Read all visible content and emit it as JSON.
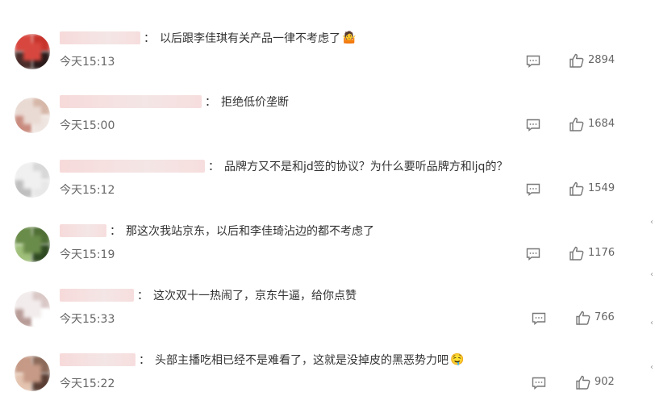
{
  "comments": [
    {
      "name_width": 100,
      "text": "以后跟李佳琪有关产品一律不考虑了",
      "emoji": "🤷",
      "time": "今天15:13",
      "likes": "2894",
      "avatar_colors": [
        "#d8473f",
        "#c7342c",
        "#4a2d2a",
        "#2c1a1a"
      ]
    },
    {
      "name_width": 176,
      "text": "拒绝低价垄断",
      "emoji": "",
      "time": "今天15:00",
      "likes": "1684",
      "avatar_colors": [
        "#e9dad3",
        "#d6b7a8",
        "#c98c7f",
        "#efe5e0"
      ]
    },
    {
      "name_width": 180,
      "text": "品牌方又不是和jd签的协议？为什么要听品牌方和ljq的？",
      "emoji": "",
      "time": "今天15:12",
      "likes": "1549",
      "avatar_colors": [
        "#f0f0f0",
        "#d8d8d8",
        "#bfbfbf",
        "#e8e8e8"
      ]
    },
    {
      "name_width": 58,
      "text": "那这次我站京东，以后和李佳琦沾边的都不考虑了",
      "emoji": "",
      "time": "今天15:19",
      "likes": "1176",
      "avatar_colors": [
        "#6a8c4a",
        "#4f6f35",
        "#9fbf7a",
        "#2f4a22"
      ]
    },
    {
      "name_width": 92,
      "text": "这次双十一热闹了，京东牛逼，给你点赞",
      "emoji": "",
      "time": "今天15:33",
      "likes": "766",
      "avatar_colors": [
        "#f2ecec",
        "#d9c8c6",
        "#b89c98",
        "#ffffff"
      ]
    },
    {
      "name_width": 94,
      "text": "头部主播吃相已经不是难看了，这就是没掉皮的黑恶势力吧",
      "emoji": "🤤",
      "time": "今天15:22",
      "likes": "902",
      "avatar_colors": [
        "#c69a86",
        "#8c6a5a",
        "#e4c4b0",
        "#5a3e34"
      ]
    }
  ]
}
